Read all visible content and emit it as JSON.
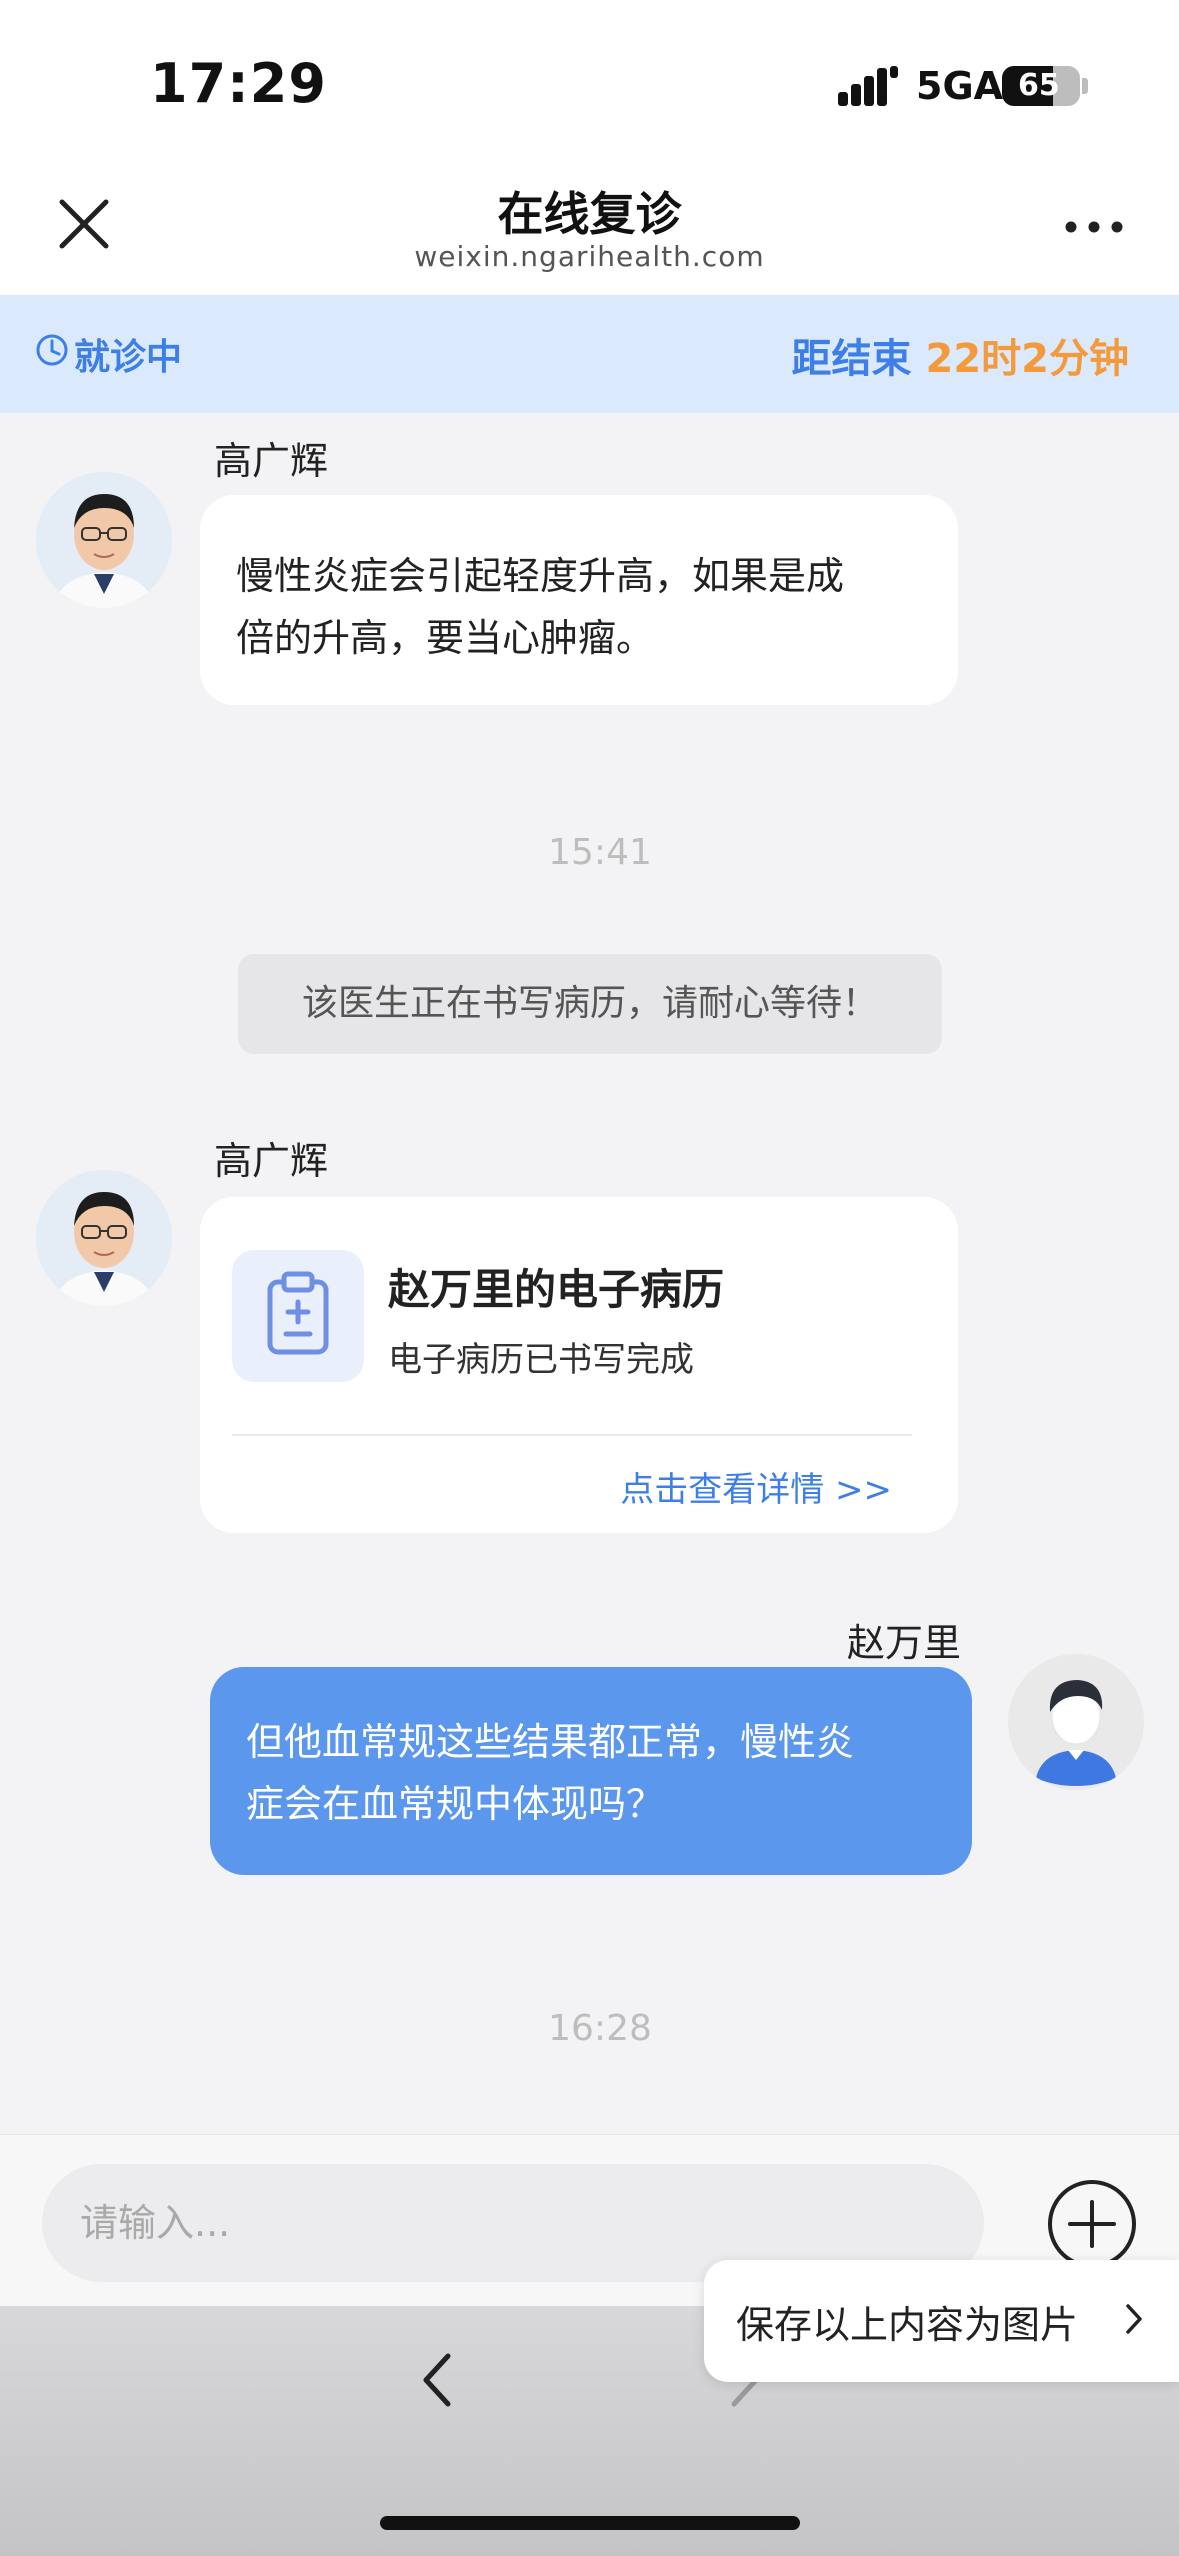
{
  "status_bar": {
    "time": "17:29",
    "network": "5GA",
    "battery": "65",
    "battery_level": 0.65
  },
  "nav": {
    "title": "在线复诊",
    "subtitle": "weixin.ngarihealth.com"
  },
  "session": {
    "status": "就诊中",
    "remaining_label": "距结束",
    "remaining_time": "22时2分钟"
  },
  "chat": {
    "doctor_name": "高广辉",
    "messages": [
      {
        "sender": "高广辉",
        "line1": "慢性炎症会引起轻度升高，如果是成",
        "line2": "倍的升高，要当心肿瘤。"
      },
      {
        "timestamp": "15:41"
      },
      {
        "system": "该医生正在书写病历，请耐心等待！"
      },
      {
        "sender": "高广辉",
        "card_title": "赵万里的电子病历",
        "card_subtitle": "电子病历已书写完成",
        "card_link": "点击查看详情 >>"
      },
      {
        "sender": "赵万里",
        "line1": "但他血常规这些结果都正常，慢性炎",
        "line2": "症会在血常规中体现吗？"
      },
      {
        "timestamp": "16:28"
      }
    ]
  },
  "input": {
    "placeholder": "请输入..."
  },
  "popup": {
    "save_label": "保存以上内容为图片"
  },
  "colors": {
    "accent_blue": "#3d7fe6",
    "bubble_blue": "#5b97ec",
    "countdown_orange": "#f39a3c",
    "banner_bg": "#dbe9fd"
  }
}
